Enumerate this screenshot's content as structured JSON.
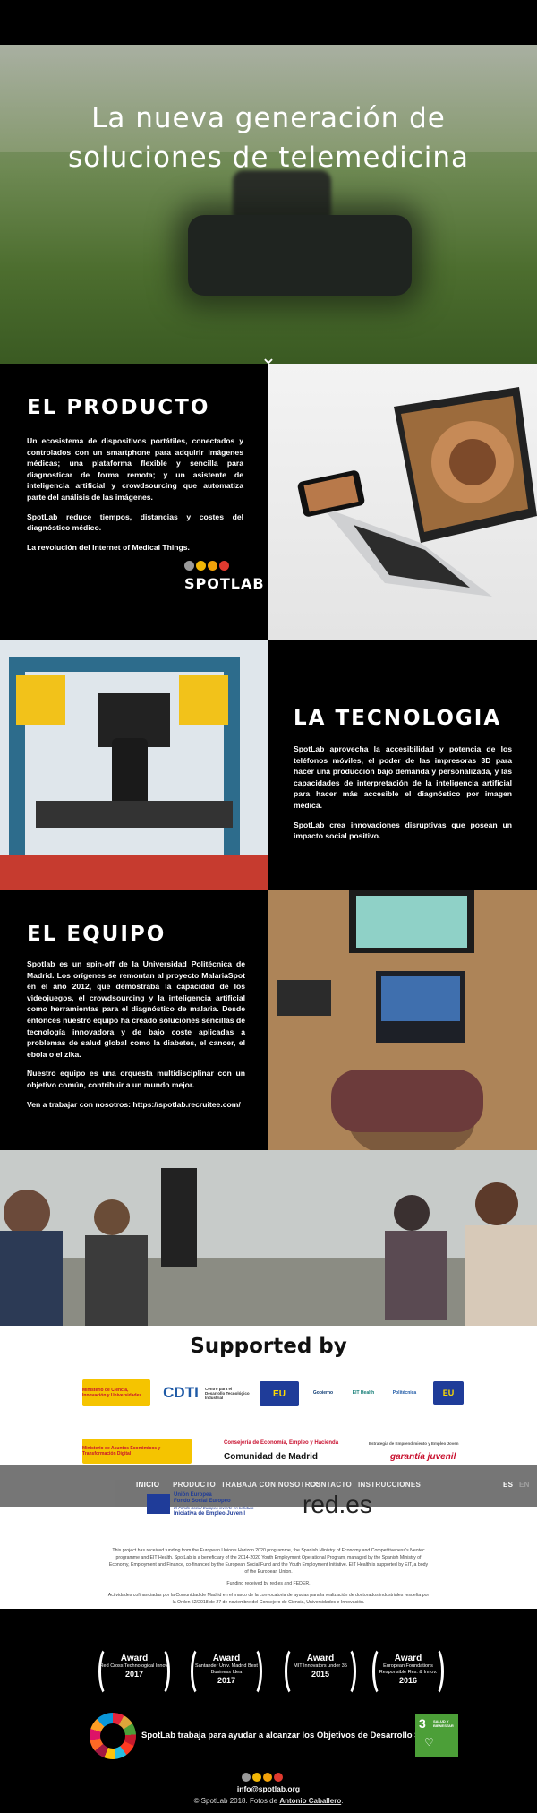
{
  "hero": {
    "title_line1": "La nueva generación de",
    "title_line2": "soluciones de telemedicina"
  },
  "producto": {
    "heading": "EL PRODUCTO",
    "p1": "Un ecosistema de dispositivos portátiles, conectados y controlados con un smartphone para adquirir imágenes médicas; una plataforma flexible y sencilla para diagnosticar de forma remota; y un asistente de inteligencia artificial y crowdsourcing que automatiza parte del análisis de las imágenes.",
    "p2": "SpotLab reduce tiempos, distancias y costes del diagnóstico médico.",
    "p3": "La revolución del Internet of Medical Things.",
    "brand": "SPOTLAB"
  },
  "tecnologia": {
    "heading": "LA TECNOLOGIA",
    "p1": "SpotLab aprovecha la accesibilidad y potencia de los teléfonos móviles, el poder de las impresoras 3D para hacer una producción bajo demanda y personalizada, y las capacidades de interpretación de la inteligencia artificial para hacer más accesible el diagnóstico por imagen médica.",
    "p2": "SpotLab crea innovaciones disruptivas que posean un impacto social positivo."
  },
  "equipo": {
    "heading": "EL EQUIPO",
    "p1": "Spotlab es un spin-off de la Universidad Politécnica de Madrid. Los orígenes se remontan al proyecto MalariaSpot en el año 2012, que demostraba la capacidad de los videojuegos, el crowdsourcing y la inteligencia artificial como herramientas para el diagnóstico de malaria. Desde entonces nuestro equipo ha creado soluciones sencillas de tecnología innovadora y de bajo coste aplicadas a problemas de salud global como la diabetes, el cancer, el ebola o el zika.",
    "p2": "Nuestro equipo es una orquesta multidisciplinar con un objetivo común, contribuir a un mundo mejor.",
    "p3": "Ven a trabajar con nosotros:  https://spotlab.recruitee.com/"
  },
  "supported": {
    "title": "Supported by",
    "logos_row1": [
      "Ministerio de Ciencia, Innovación y Universidades",
      "CDTI",
      "Centro para el Desarrollo Tecnológico Industrial",
      "EU",
      "Gobierno",
      "EIT Health",
      "Politécnica",
      "EU"
    ],
    "logos_row2": [
      "Ministerio de Asuntos Económicos y Transformación Digital",
      "Consejería de Economía, Empleo y Hacienda",
      "Comunidad de Madrid",
      "Estrategia de Emprendimiento y Empleo Joven",
      "garantía juvenil"
    ],
    "logos_row3": [
      "Unión Europea",
      "Fondo Social Europeo",
      "El Fondo Social Europeo invierte en tu futuro",
      "Iniciativa de Empleo Juvenil",
      "red.es"
    ],
    "note1": "This project has received funding from the European Union's Horizon 2020 programme, the Spanish Ministry of Economy and Competitiveness's Neotec programme and EIT Health. SpotLab is a beneficiary of the 2014-2020 Youth Employment Operational Program, managed by the Spanish Ministry of Economy, Employment and Finance, co-financed by the European Social Fund and the Youth Employment Initiative. EIT Health is supported by EIT, a body of the European Union.",
    "note2": "Funding received by red.es and FEDER.",
    "note3": "Actividades cofinanciadas por la Comunidad de Madrid en el marco de la convocatoria de ayudas para la realización de doctorados industriales resuelta por la Orden 52/2018 de 27 de noviembre del Consejero de Ciencia, Universidades e Innovación."
  },
  "nav": {
    "items": [
      "INICIO",
      "PRODUCTO",
      "TRABAJA CON NOSOTROS",
      "CONTACTO",
      "INSTRUCCIONES"
    ],
    "lang_es": "ES",
    "lang_en": "EN"
  },
  "awards": [
    {
      "title": "Award",
      "sub": "Red Cross Technological Innov.",
      "year": "2017"
    },
    {
      "title": "Award",
      "sub": "Santander Univ. Madrid Best Business Idea",
      "year": "2017"
    },
    {
      "title": "Award",
      "sub": "MIT Innovators under 35",
      "year": "2015"
    },
    {
      "title": "Award",
      "sub": "European Foundations Responsible Res. & Innov.",
      "year": "2016"
    }
  ],
  "sdg": {
    "text": "SpotLab trabaja para ayudar a alcanzar los Objetivos de Desarrollo Sostenible",
    "badge_num": "3",
    "badge_text": "SALUD Y BIENESTAR"
  },
  "footer": {
    "email": "info@spotlab.org",
    "copyright_prefix": "© SpotLab 2018. Fotos de ",
    "photographer": "Antonio Caballero",
    "copyright_suffix": "."
  },
  "colors": {
    "dot1": "#9a9a9a",
    "dot2": "#f2b705",
    "dot3": "#f2a20a",
    "dot4": "#e03a2f",
    "accent_red": "#c8102e"
  }
}
